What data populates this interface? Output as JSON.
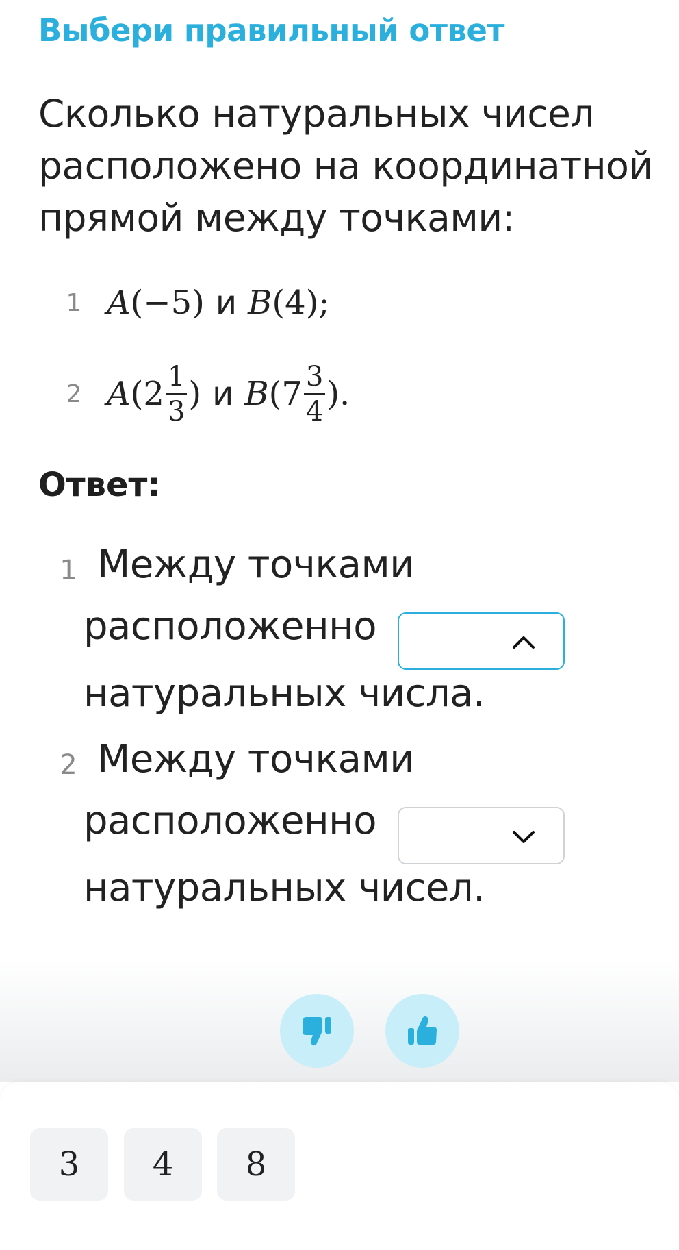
{
  "header": {
    "title": "Выбери правильный ответ"
  },
  "question": {
    "text": "Сколько натуральных чисел расположено на координатной прямой между точками:",
    "items": [
      {
        "number": "1",
        "a_label": "A",
        "a_value": "(−5)",
        "conjunction": "и",
        "b_label": "B",
        "b_value": "(4);"
      },
      {
        "number": "2",
        "a_label": "A",
        "a_open": "(2",
        "a_frac_num": "1",
        "a_frac_den": "3",
        "a_close": ")",
        "conjunction": "и",
        "b_label": "B",
        "b_open": "(7",
        "b_frac_num": "3",
        "b_frac_den": "4",
        "b_close": ")."
      }
    ]
  },
  "answer": {
    "heading": "Ответ:",
    "items": [
      {
        "number": "1",
        "line1": "Между точками",
        "line2": "расположенно",
        "line3": "натуральных числа.",
        "dropdown": {
          "selected": "",
          "state": "open",
          "icon": "chevron-up-icon"
        }
      },
      {
        "number": "2",
        "line1": "Между точками",
        "line2": "расположенно",
        "line3": "натуральных чисел.",
        "dropdown": {
          "selected": "",
          "state": "closed",
          "icon": "chevron-down-icon"
        }
      }
    ]
  },
  "feedback": {
    "dislike_icon": "thumbs-down-icon",
    "like_icon": "thumbs-up-icon",
    "accent_color": "#2bb0de",
    "button_bg": "#c7eef9"
  },
  "options": [
    "3",
    "4",
    "8"
  ]
}
